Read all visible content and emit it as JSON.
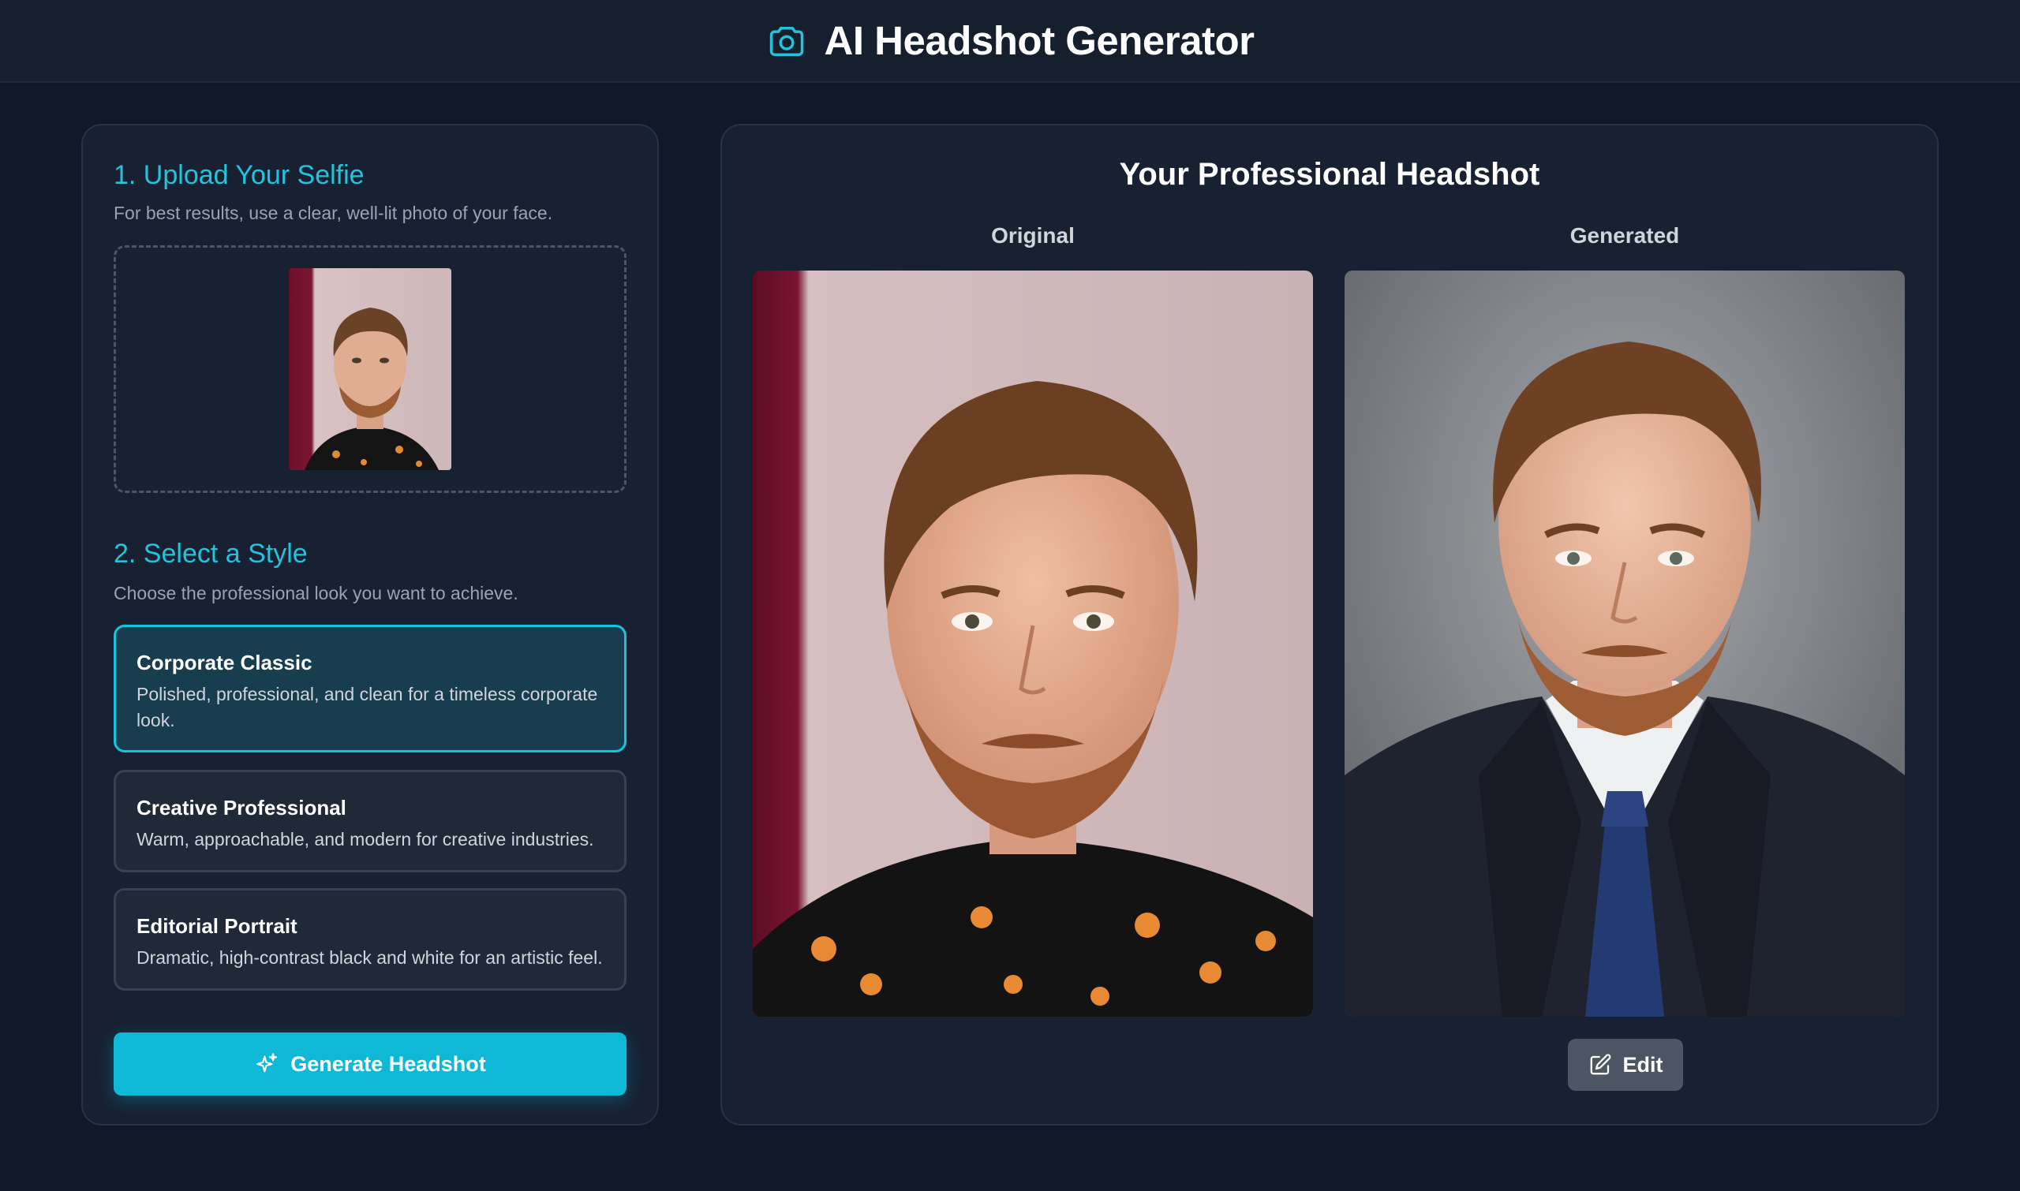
{
  "header": {
    "title": "AI Headshot Generator",
    "icon": "camera-icon"
  },
  "upload": {
    "title": "1. Upload Your Selfie",
    "subtitle": "For best results, use a clear, well-lit photo of your face."
  },
  "styles": {
    "title": "2. Select a Style",
    "subtitle": "Choose the professional look you want to achieve.",
    "options": [
      {
        "name": "Corporate Classic",
        "description": "Polished, professional, and clean for a timeless corporate look.",
        "selected": true
      },
      {
        "name": "Creative Professional",
        "description": "Warm, approachable, and modern for creative industries.",
        "selected": false
      },
      {
        "name": "Editorial Portrait",
        "description": "Dramatic, high-contrast black and white for an artistic feel.",
        "selected": false
      }
    ]
  },
  "generate_button": {
    "label": "Generate Headshot",
    "icon": "sparkles-icon"
  },
  "result": {
    "title": "Your Professional Headshot",
    "original_label": "Original",
    "generated_label": "Generated",
    "edit_label": "Edit",
    "edit_icon": "pencil-square-icon"
  },
  "colors": {
    "background": "#111827",
    "panel": "#172131",
    "accent": "#16c3dd",
    "selected_card": "#173d4f",
    "edit_button": "#4b5563"
  }
}
